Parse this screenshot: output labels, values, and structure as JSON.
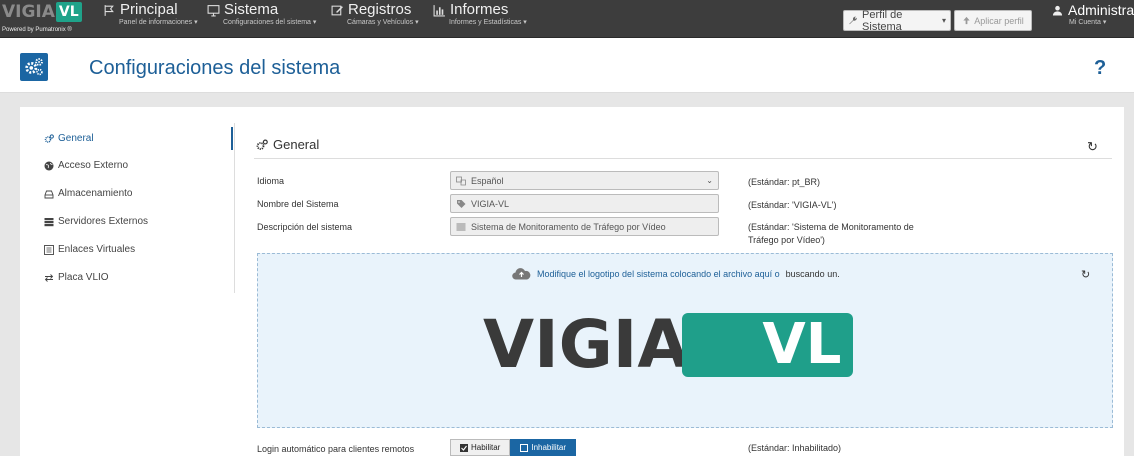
{
  "brand": {
    "logo_text": "VIGIA",
    "logo_badge": "VL",
    "powered_by": "Powered by Pumatronix ®"
  },
  "nav": {
    "items": [
      {
        "label": "Principal",
        "sub": "Panel de informaciones ▾",
        "icon": "flag-icon"
      },
      {
        "label": "Sistema",
        "sub": "Configuraciones del sistema ▾",
        "icon": "monitor-icon"
      },
      {
        "label": "Registros",
        "sub": "Cámaras y Vehículos ▾",
        "icon": "edit-icon"
      },
      {
        "label": "Informes",
        "sub": "Informes y Estadísticas ▾",
        "icon": "bar-chart-icon"
      }
    ],
    "profile_select": "Perfil de Sistema",
    "apply_button": "Aplicar perfil",
    "user": {
      "label": "Administrador",
      "sub": "Mi Cuenta ▾"
    }
  },
  "header": {
    "title": "Configuraciones del sistema",
    "help": "?"
  },
  "sidebar": {
    "items": [
      {
        "label": "General",
        "icon": "cogs-icon",
        "active": true
      },
      {
        "label": "Acceso Externo",
        "icon": "globe-icon",
        "active": false
      },
      {
        "label": "Almacenamiento",
        "icon": "storage-icon",
        "active": false
      },
      {
        "label": "Servidores Externos",
        "icon": "server-icon",
        "active": false
      },
      {
        "label": "Enlaces Virtuales",
        "icon": "link-icon",
        "active": false
      },
      {
        "label": "Placa VLIO",
        "icon": "exchange-icon",
        "active": false
      }
    ]
  },
  "section": {
    "title": "General",
    "reset": "↻"
  },
  "form": {
    "idioma": {
      "label": "Idioma",
      "value": "Español",
      "default": "(Estándar: pt_BR)"
    },
    "nombre": {
      "label": "Nombre del Sistema",
      "value": "VIGIA-VL",
      "default": "(Estándar: 'VIGIA-VL')"
    },
    "descripcion": {
      "label": "Descripción del sistema",
      "value": "Sistema de Monitoramento de Tráfego por Vídeo",
      "default_line1": "(Estándar: 'Sistema de Monitoramento de",
      "default_line2": "Tráfego por Vídeo')"
    }
  },
  "dropzone": {
    "text": "Modifique el logotipo del sistema colocando el archivo aquí o",
    "link": "buscando un.",
    "reset": "↻",
    "logo_text": "VIGIA",
    "logo_badge": "VL"
  },
  "login": {
    "label": "Login automático para clientes remotos",
    "enable": "Habilitar",
    "disable": "Inhabilitar",
    "default": "(Estándar: Inhabilitado)"
  },
  "colors": {
    "accent": "#1d5f97",
    "brand_green": "#1f9f8a",
    "navbar": "#3d3d3d"
  }
}
